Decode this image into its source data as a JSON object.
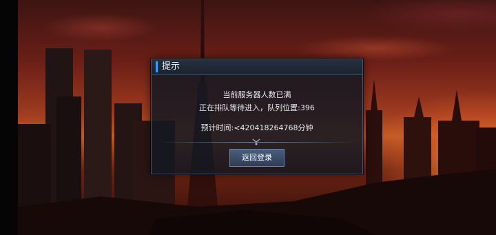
{
  "dialog": {
    "title": "提示",
    "message_line1": "当前服务器人数已满",
    "message_line2": "正在排队等待进入，队列位置:396",
    "estimate_line": "预计时间:<420418264768分钟",
    "button_label": "返回登录"
  },
  "colors": {
    "accent": "#3aa0ff",
    "panel_bg": "#14182266",
    "button_bg": "#3b4c69"
  },
  "icons": {
    "divider": "chevron-diamond-icon"
  }
}
